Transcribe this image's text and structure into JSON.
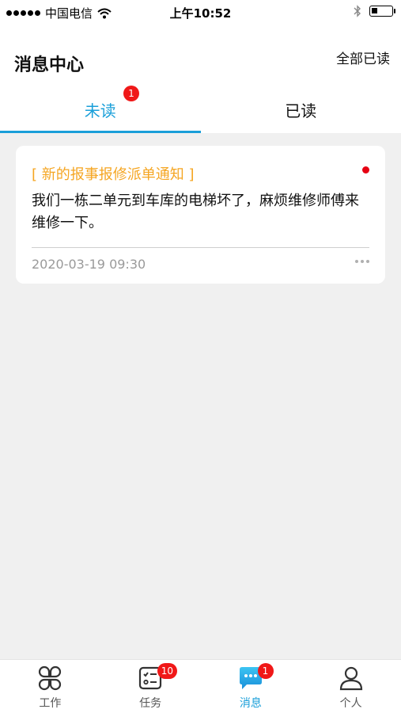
{
  "status_bar": {
    "carrier": "中国电信",
    "time": "上午10:52",
    "battery_level": 0.3
  },
  "header": {
    "title": "消息中心",
    "mark_all_read": "全部已读"
  },
  "tabs": [
    {
      "label": "未读",
      "active": true,
      "badge": "1"
    },
    {
      "label": "已读",
      "active": false
    }
  ],
  "messages": [
    {
      "title": "[ 新的报事报修派单通知 ]",
      "body": "我们一栋二单元到车库的电梯坏了，麻烦维修师傅来维修一下。",
      "time": "2020-03-19 09:30",
      "unread": true
    }
  ],
  "bottom_nav": {
    "items": [
      {
        "label": "工作",
        "icon": "work-icon",
        "active": false
      },
      {
        "label": "任务",
        "icon": "task-icon",
        "active": false,
        "badge": "10"
      },
      {
        "label": "消息",
        "icon": "message-icon",
        "active": true,
        "badge": "1"
      },
      {
        "label": "个人",
        "icon": "person-icon",
        "active": false
      }
    ]
  },
  "colors": {
    "accent": "#1a9fd9",
    "title_orange": "#f5a623",
    "badge_red": "#f01818"
  }
}
